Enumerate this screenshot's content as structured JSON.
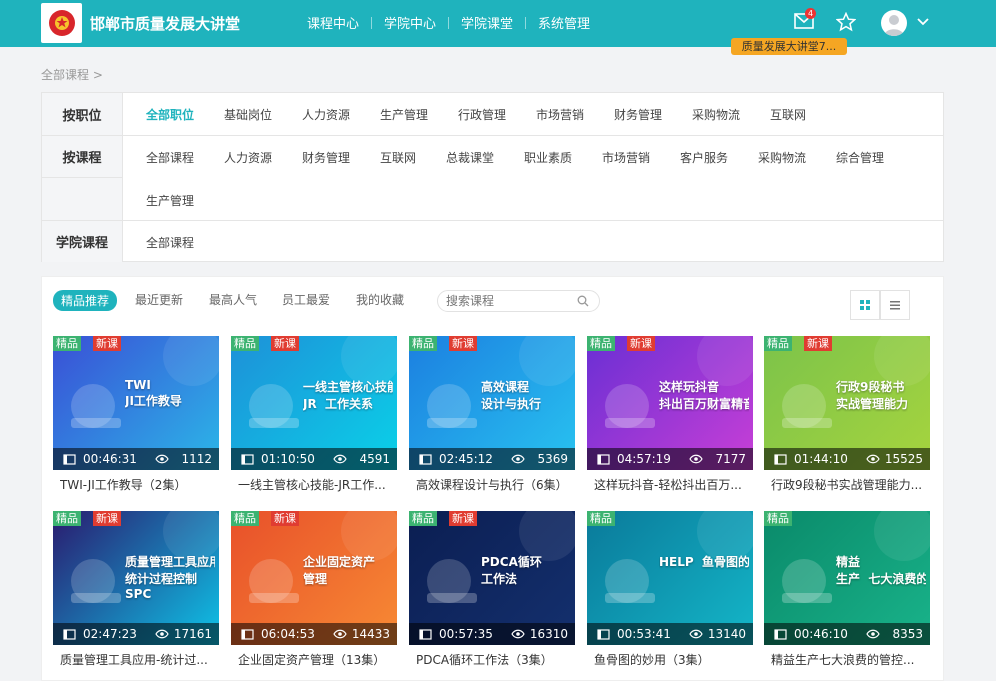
{
  "header": {
    "site_title": "邯郸市质量发展大讲堂",
    "nav": [
      "课程中心",
      "学院中心",
      "学院课堂",
      "系统管理"
    ],
    "mail_badge": "4",
    "tooltip": "质量发展大讲堂7...",
    "brand_color": "#1fb3bd"
  },
  "breadcrumb": "全部课程 >",
  "filters": {
    "position": {
      "label": "按职位",
      "options": [
        "全部职位",
        "基础岗位",
        "人力资源",
        "生产管理",
        "行政管理",
        "市场营销",
        "财务管理",
        "采购物流",
        "互联网"
      ],
      "active": "全部职位"
    },
    "course": {
      "label": "按课程",
      "options": [
        "全部课程",
        "人力资源",
        "财务管理",
        "互联网",
        "总裁课堂",
        "职业素质",
        "市场营销",
        "客户服务",
        "采购物流",
        "综合管理",
        "生产管理"
      ]
    },
    "academy": {
      "label": "学院课程",
      "options": [
        "全部课程"
      ]
    }
  },
  "tabs": [
    "精品推荐",
    "最近更新",
    "最高人气",
    "员工最爱",
    "我的收藏"
  ],
  "active_tab": "精品推荐",
  "search": {
    "placeholder": "搜索课程"
  },
  "tag_labels": {
    "jingpin": "精品",
    "xinke": "新课"
  },
  "courses": [
    {
      "title": "TWI-JI工作教导（2集）",
      "duration": "00:46:31",
      "views": "1112",
      "jingpin": true,
      "xinke": true,
      "overlay": "TWI\nJI工作教导",
      "bg": [
        "#3a4fd6",
        "#2bb7e8"
      ]
    },
    {
      "title": "一线主管核心技能-JR工作...",
      "duration": "01:10:50",
      "views": "4591",
      "jingpin": true,
      "xinke": true,
      "overlay": "一线主管核心技能\nJR  工作关系",
      "bg": [
        "#1e90d8",
        "#0ad1e8"
      ]
    },
    {
      "title": "高效课程设计与执行（6集）",
      "duration": "02:45:12",
      "views": "5369",
      "jingpin": true,
      "xinke": true,
      "overlay": "高效课程\n设计与执行",
      "bg": [
        "#1c7fe0",
        "#28c3f0"
      ]
    },
    {
      "title": "这样玩抖音-轻松抖出百万...",
      "duration": "04:57:19",
      "views": "7177",
      "jingpin": true,
      "xinke": true,
      "overlay": "这样玩抖音\n抖出百万财富精音",
      "bg": [
        "#6a2fd4",
        "#c83fd6"
      ]
    },
    {
      "title": "行政9段秘书实战管理能力...",
      "duration": "01:44:10",
      "views": "15525",
      "jingpin": true,
      "xinke": true,
      "overlay": "行政9段秘书\n实战管理能力",
      "bg": [
        "#7cc34a",
        "#a6d43e"
      ]
    },
    {
      "title": "质量管理工具应用-统计过...",
      "duration": "02:47:23",
      "views": "17161",
      "jingpin": true,
      "xinke": true,
      "overlay": "质量管理工具应用\n统计过程控制\nSPC",
      "bg": [
        "#2a1a6e",
        "#0ec4e8"
      ]
    },
    {
      "title": "企业固定资产管理（13集）",
      "duration": "06:04:53",
      "views": "14433",
      "jingpin": true,
      "xinke": true,
      "overlay": "企业固定资产\n管理",
      "bg": [
        "#e8502a",
        "#f78a34"
      ]
    },
    {
      "title": "PDCA循环工作法（3集）",
      "duration": "00:57:35",
      "views": "16310",
      "jingpin": true,
      "xinke": true,
      "overlay": "PDCA循环\n工作法",
      "bg": [
        "#0b1e52",
        "#14306e"
      ]
    },
    {
      "title": "鱼骨图的妙用（3集）",
      "duration": "00:53:41",
      "views": "13140",
      "jingpin": true,
      "xinke": false,
      "overlay": "HELP  鱼骨图的妙用",
      "bg": [
        "#0a7a9a",
        "#14b6c8"
      ]
    },
    {
      "title": "精益生产七大浪费的管控...",
      "duration": "00:46:10",
      "views": "8353",
      "jingpin": true,
      "xinke": false,
      "overlay": "精益\n生产  七大浪费的管控",
      "bg": [
        "#0a8a6a",
        "#19b38a"
      ]
    }
  ]
}
